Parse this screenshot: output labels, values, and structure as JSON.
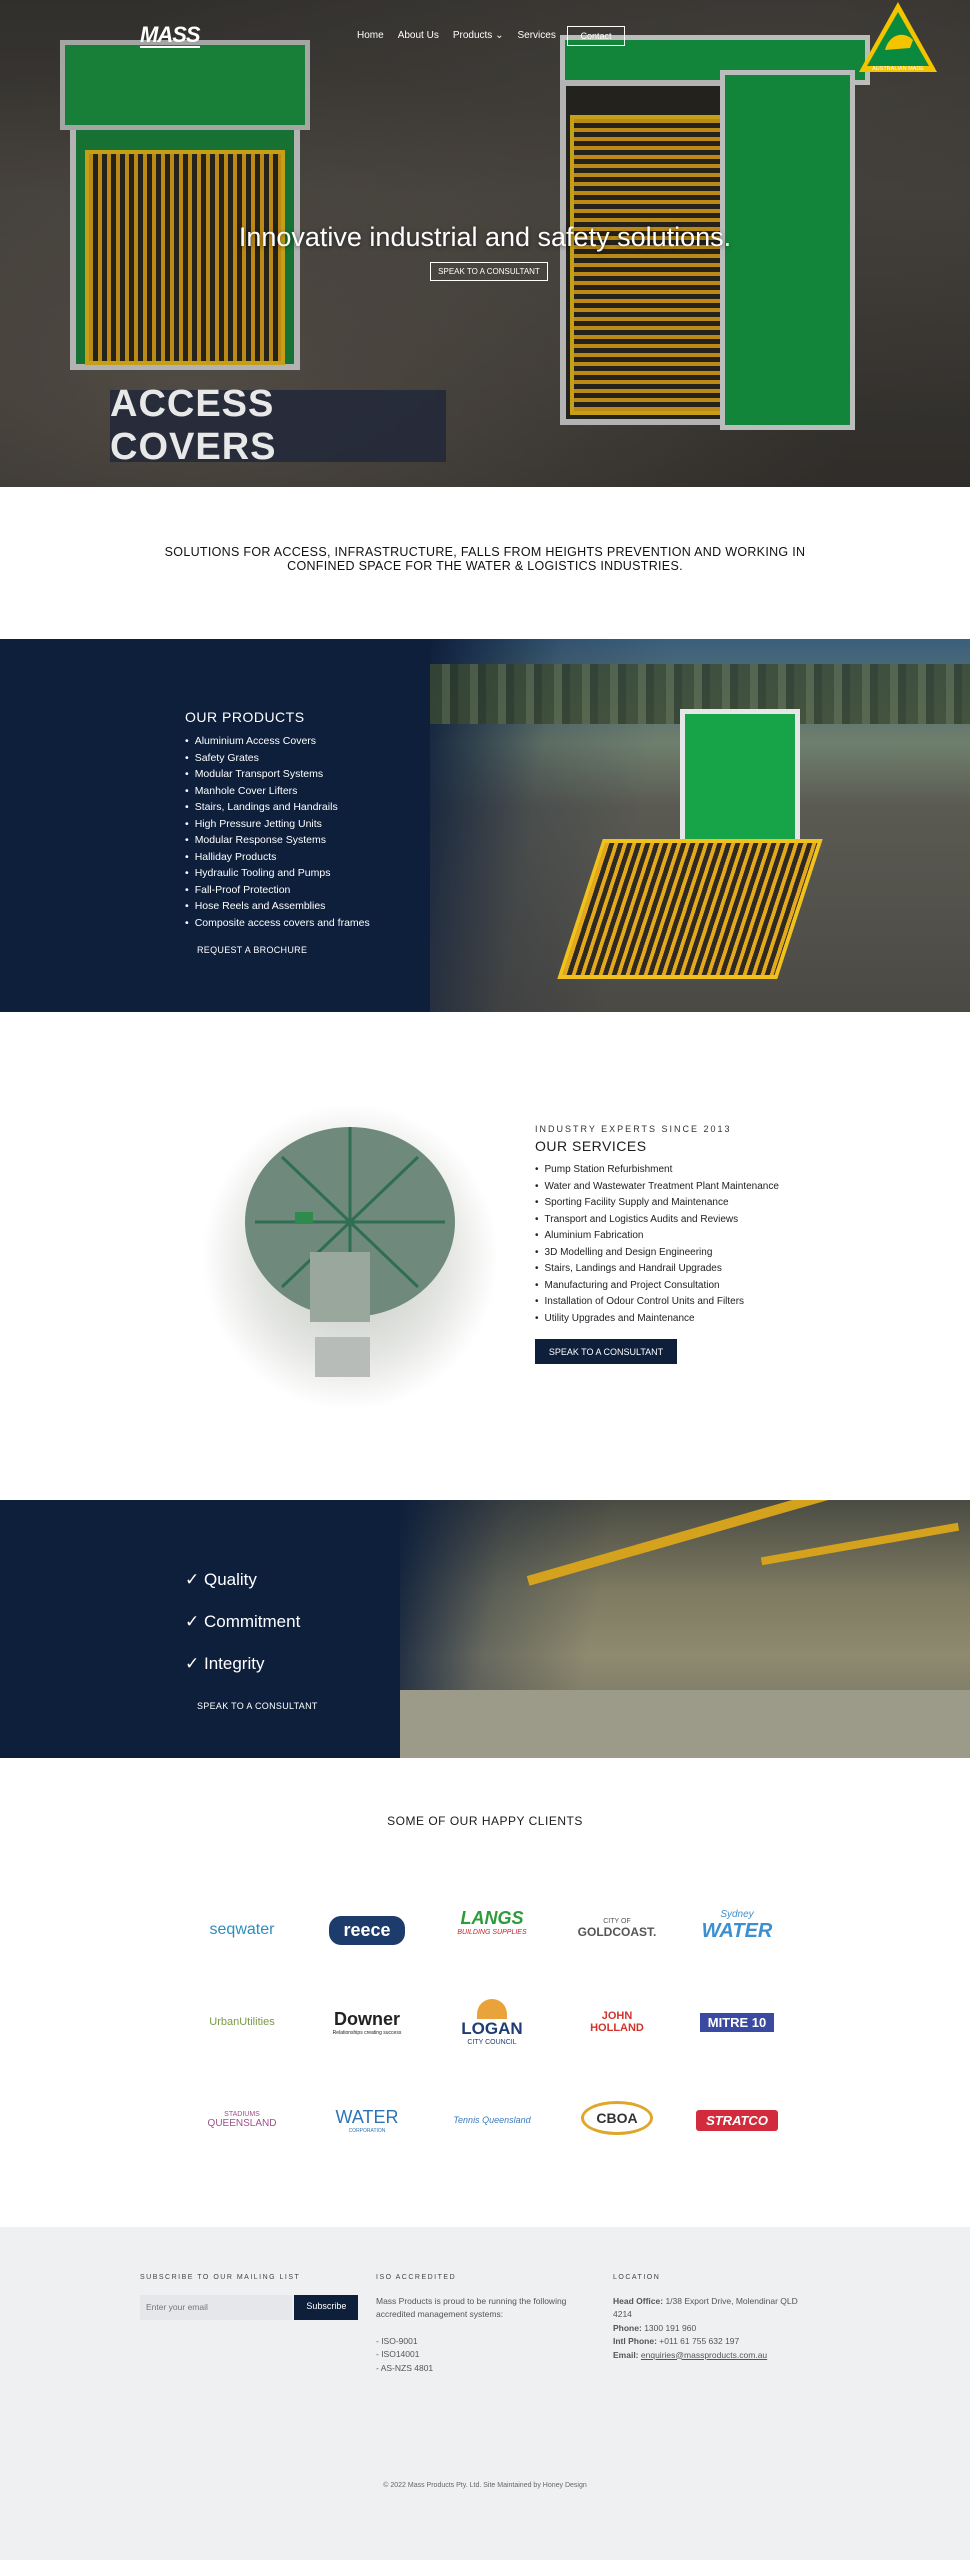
{
  "nav": {
    "logo": "MASS",
    "items": [
      "Home",
      "About Us",
      "Products",
      "Services"
    ],
    "products_chevron": "chevron-down-icon",
    "contact": "Contact",
    "badge_text": "AUSTRALIAN MADE"
  },
  "hero": {
    "title": "Innovative industrial and safety solutions.",
    "button": "SPEAK TO A CONSULTANT",
    "image_label": "ACCESS COVERS"
  },
  "intro": "SOLUTIONS FOR ACCESS, INFRASTRUCTURE, FALLS FROM HEIGHTS PREVENTION AND WORKING IN CONFINED SPACE FOR THE WATER & LOGISTICS INDUSTRIES.",
  "products": {
    "title": "OUR PRODUCTS",
    "items": [
      "Aluminium Access Covers",
      "Safety Grates",
      "Modular Transport Systems",
      "Manhole Cover Lifters",
      "Stairs, Landings and Handrails",
      "High Pressure Jetting Units",
      "Modular Response Systems",
      "Halliday Products",
      "Hydraulic Tooling and Pumps",
      "Fall-Proof Protection",
      "Hose Reels and Assemblies",
      "Composite access covers and frames"
    ],
    "button": "REQUEST A BROCHURE"
  },
  "services": {
    "eyebrow": "INDUSTRY EXPERTS SINCE 2013",
    "title": "OUR SERVICES",
    "items": [
      "Pump Station Refurbishment",
      "Water and Wastewater Treatment Plant Maintenance",
      "Sporting Facility Supply and Maintenance",
      "Transport and Logistics Audits and Reviews",
      "Aluminium Fabrication",
      "3D Modelling and Design Engineering",
      "Stairs, Landings and Handrail Upgrades",
      "Manufacturing and Project Consultation",
      "Installation of Odour Control Units and Filters",
      "Utility Upgrades and Maintenance"
    ],
    "button": "SPEAK TO A CONSULTANT"
  },
  "values": {
    "items": [
      "✓ Quality",
      "✓ Commitment",
      "✓ Integrity"
    ],
    "button": "SPEAK TO A CONSULTANT"
  },
  "clients": {
    "title": "SOME OF OUR HAPPY CLIENTS",
    "logos": [
      {
        "name": "seqwater",
        "sub": "",
        "color": "#2a8fbf"
      },
      {
        "name": "reece",
        "sub": "",
        "color": "#ffffff"
      },
      {
        "name": "LANGS",
        "sub": "BUILDING SUPPLIES",
        "color": "#2d9b3a"
      },
      {
        "name": "GOLDCOAST.",
        "sub": "CITY OF",
        "color": "#555555"
      },
      {
        "name": "WATER",
        "sub": "Sydney",
        "color": "#3c8fd0"
      },
      {
        "name": "UrbanUtilities",
        "sub": "",
        "color": "#7a9a4a"
      },
      {
        "name": "Downer",
        "sub": "Relationships creating success",
        "color": "#222222"
      },
      {
        "name": "LOGAN",
        "sub": "CITY COUNCIL",
        "color": "#1f3c73"
      },
      {
        "name": "JOHN HOLLAND",
        "sub": "",
        "color": "#d0342c"
      },
      {
        "name": "MITRE 10",
        "sub": "",
        "color": "#ffffff"
      },
      {
        "name": "QUEENSLAND",
        "sub": "STADIUMS",
        "color": "#a0508a"
      },
      {
        "name": "WATER",
        "sub": "CORPORATION",
        "color": "#2c74b8"
      },
      {
        "name": "Tennis Queensland",
        "sub": "",
        "color": "#3a7bbd"
      },
      {
        "name": "CBOA",
        "sub": "",
        "color": "#333333"
      },
      {
        "name": "STRATCO",
        "sub": "",
        "color": "#ffffff"
      }
    ]
  },
  "footer": {
    "subscribe_heading": "SUBSCRIBE TO OUR MAILING LIST",
    "email_placeholder": "Enter your email",
    "subscribe_button": "Subscribe",
    "iso_heading": "ISO ACCREDITED",
    "iso_text": "Mass Products is proud to be running the following accredited management systems:",
    "iso_items": [
      "- ISO-9001",
      "- ISO14001",
      "- AS-NZS 4801"
    ],
    "location_heading": "LOCATION",
    "head_office_label": "Head Office:",
    "head_office": "1/38 Export Drive, Molendinar QLD 4214",
    "phone_label": "Phone:",
    "phone": "1300 191 960",
    "intl_label": "Intl Phone:",
    "intl": "+011 61 755 632 197",
    "email_label": "Email:",
    "email": "enquiries@massproducts.com.au",
    "copyright": "© 2022 Mass Products Pty. Ltd. Site Maintained by Honey Design"
  },
  "colors": {
    "navy": "#0e1f3b",
    "green": "#17a347",
    "yellow": "#e4a81c"
  }
}
